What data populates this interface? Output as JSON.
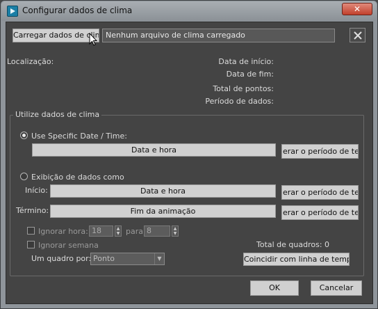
{
  "window": {
    "title": "Configurar dados de clima",
    "close_label": "✕"
  },
  "file": {
    "load_button": "Carregar dados de clima",
    "status_text": "Nenhum arquivo de clima carregado"
  },
  "info": {
    "location_label": "Localização:",
    "start_date_label": "Data de início:",
    "end_date_label": "Data de fim:",
    "total_points_label": "Total de pontos:",
    "data_period_label": "Período de dados:"
  },
  "group": {
    "title": "Utilize dados de clima",
    "specific_date": {
      "radio_label": "Use Specific Date / Time:",
      "selected": true,
      "date_button": "Data e hora",
      "period_button": "erar o período de temp"
    },
    "display_as": {
      "radio_label": "Exibição de dados como",
      "selected": false,
      "start_label": "Início:",
      "start_button": "Data e hora",
      "start_period_button": "erar o período de temp",
      "end_label": "Término:",
      "end_button": "Fim da animação",
      "end_period_button": "erar o período de temp"
    },
    "ignore_hour": {
      "label": "Ignorar hora:",
      "from_value": "18",
      "to_label": "para",
      "to_value": "8"
    },
    "ignore_week": {
      "label": "Ignorar semana"
    },
    "frame_per": {
      "label": "Um quadro por:",
      "value": "Ponto"
    },
    "total_frames": "Total de quadros: 0",
    "match_timeline_button": "Coincidir com linha de tempo"
  },
  "footer": {
    "ok": "OK",
    "cancel": "Cancelar"
  },
  "colors": {
    "title_bar": "#9aa0a6",
    "close": "#c7432f",
    "panel": "#444444"
  }
}
